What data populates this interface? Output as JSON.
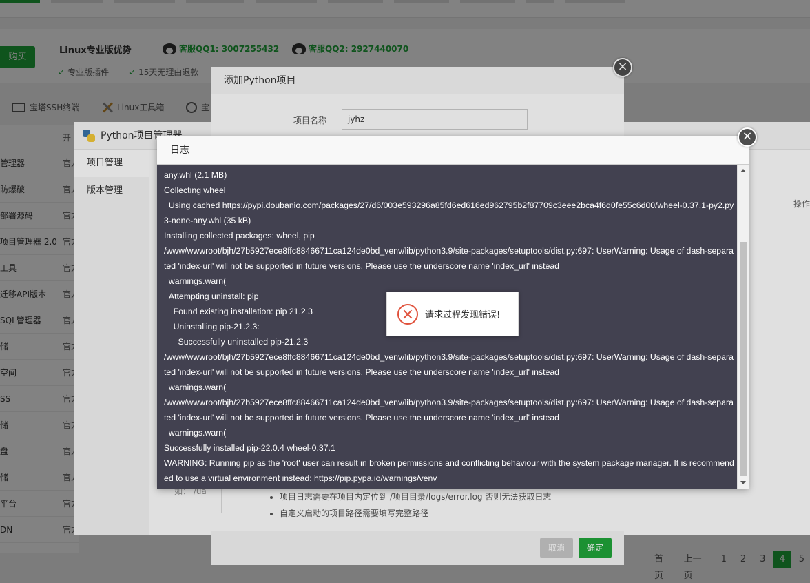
{
  "promo": {
    "buy_label": "购买",
    "title": "Linux专业版优势",
    "qq1": "客服QQ1: 3007255432",
    "qq2": "客服QQ2: 2927440070",
    "feature1": "专业版插件",
    "feature2": "15天无理由退款"
  },
  "toolbar": {
    "ssh": "宝塔SSH终端",
    "linux_tools": "Linux工具箱",
    "third": "宝"
  },
  "soft_list": {
    "header": "开",
    "rows": [
      {
        "name": "管理器",
        "type": "官方"
      },
      {
        "name": "防爆破",
        "type": "官方"
      },
      {
        "name": "部署源码",
        "type": "官方"
      },
      {
        "name": "项目管理器 2.0",
        "type": "官方"
      },
      {
        "name": "工具",
        "type": "官方"
      },
      {
        "name": "迁移API版本",
        "type": "官方"
      },
      {
        "name": "SQL管理器",
        "type": "官方"
      },
      {
        "name": "储",
        "type": "官方"
      },
      {
        "name": "空间",
        "type": "官方"
      },
      {
        "name": "SS",
        "type": "官方"
      },
      {
        "name": "储",
        "type": "官方"
      },
      {
        "name": "盘",
        "type": "官方"
      },
      {
        "name": "储",
        "type": "官方"
      },
      {
        "name": "平台",
        "type": "官方"
      },
      {
        "name": "DN",
        "type": "官方"
      }
    ]
  },
  "pager": {
    "first": "首页",
    "prev": "上一页",
    "pages": [
      "1",
      "2",
      "3",
      "4",
      "5"
    ],
    "current": "4"
  },
  "python_manager": {
    "title": "Python项目管理器",
    "nav": [
      "项目管理",
      "版本管理"
    ],
    "col_ops": "操作"
  },
  "add_project": {
    "title": "添加Python项目",
    "name_label": "项目名称",
    "name_value": "jyhz",
    "hint_prefix": "如：",
    "hint_value": "/ua",
    "tips": [
      "项目日志需要在项目内定位到 /项目目录/logs/error.log 否则无法获取日志",
      "自定义启动的项目路径需要填写完整路径"
    ],
    "cancel": "取消",
    "confirm": "确定"
  },
  "log_dialog": {
    "title": "日志",
    "lines": [
      "any.whl (2.1 MB)",
      "Collecting wheel",
      "  Using cached https://pypi.doubanio.com/packages/27/d6/003e593296a85fd6ed616ed962795b2f87709c3eee2bca4f6d0fe55c6d00/wheel-0.37.1-py2.py3-none-any.whl (35 kB)",
      "Installing collected packages: wheel, pip",
      "/www/wwwroot/bjh/27b5927ece8ffc88466711ca124de0bd_venv/lib/python3.9/site-packages/setuptools/dist.py:697: UserWarning: Usage of dash-separated 'index-url' will not be supported in future versions. Please use the underscore name 'index_url' instead",
      "  warnings.warn(",
      "  Attempting uninstall: pip",
      "    Found existing installation: pip 21.2.3",
      "    Uninstalling pip-21.2.3:",
      "      Successfully uninstalled pip-21.2.3",
      "/www/wwwroot/bjh/27b5927ece8ffc88466711ca124de0bd_venv/lib/python3.9/site-packages/setuptools/dist.py:697: UserWarning: Usage of dash-separated 'index-url' will not be supported in future versions. Please use the underscore name 'index_url' instead",
      "  warnings.warn(",
      "/www/wwwroot/bjh/27b5927ece8ffc88466711ca124de0bd_venv/lib/python3.9/site-packages/setuptools/dist.py:697: UserWarning: Usage of dash-separated 'index-url' will not be supported in future versions. Please use the underscore name 'index_url' instead",
      "  warnings.warn(",
      "Successfully installed pip-22.0.4 wheel-0.37.1",
      "WARNING: Running pip as the 'root' user can result in broken permissions and conflicting behaviour with the system package manager. It is recommended to use a virtual environment instead: https://pip.pypa.io/warnings/venv"
    ]
  },
  "toast": {
    "message": "请求过程发现错误!"
  },
  "colors": {
    "accent": "#20a53a",
    "log_bg": "#424150",
    "error": "#e0513b"
  }
}
